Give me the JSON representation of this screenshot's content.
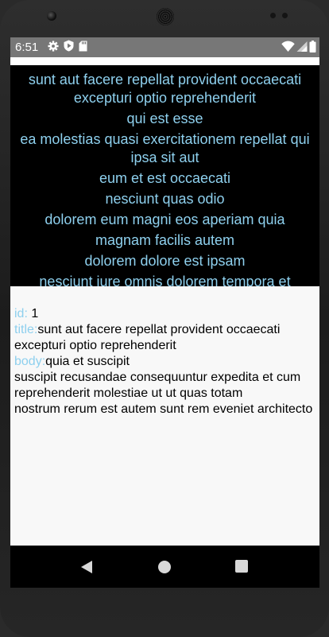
{
  "status_bar": {
    "time": "6:51",
    "left_icons": [
      "gear-icon",
      "shield-play-icon",
      "sd-card-icon"
    ],
    "right_icons": [
      "wifi-icon",
      "signal-icon",
      "battery-icon"
    ]
  },
  "posts_list": {
    "items": [
      "sunt aut facere repellat provident occaecati excepturi optio reprehenderit",
      "qui est esse",
      "ea molestias quasi exercitationem repellat qui ipsa sit aut",
      "eum et est occaecati",
      "nesciunt quas odio",
      "dolorem eum magni eos aperiam quia",
      "magnam facilis autem",
      "dolorem dolore est ipsam",
      "nesciunt iure omnis dolorem tempora et accusantium"
    ]
  },
  "detail": {
    "id_label": "id:",
    "id_value": " 1",
    "title_label": "title:",
    "title_value": "sunt aut facere repellat provident occaecati excepturi optio reprehenderit",
    "body_label": "body:",
    "body_line1": "quia et suscipit",
    "body_line2": "suscipit recusandae consequuntur expedita et cum",
    "body_line3": "reprehenderit molestiae ut ut quas totam",
    "body_line4": "nostrum rerum est autem sunt rem eveniet architecto"
  },
  "nav_bar": {
    "buttons": [
      "back-icon",
      "home-icon",
      "recents-icon"
    ]
  },
  "colors": {
    "accent": "#8ed0ee",
    "status_bar": "#777777",
    "list_background": "#000000",
    "detail_background": "#f8f8f8"
  }
}
